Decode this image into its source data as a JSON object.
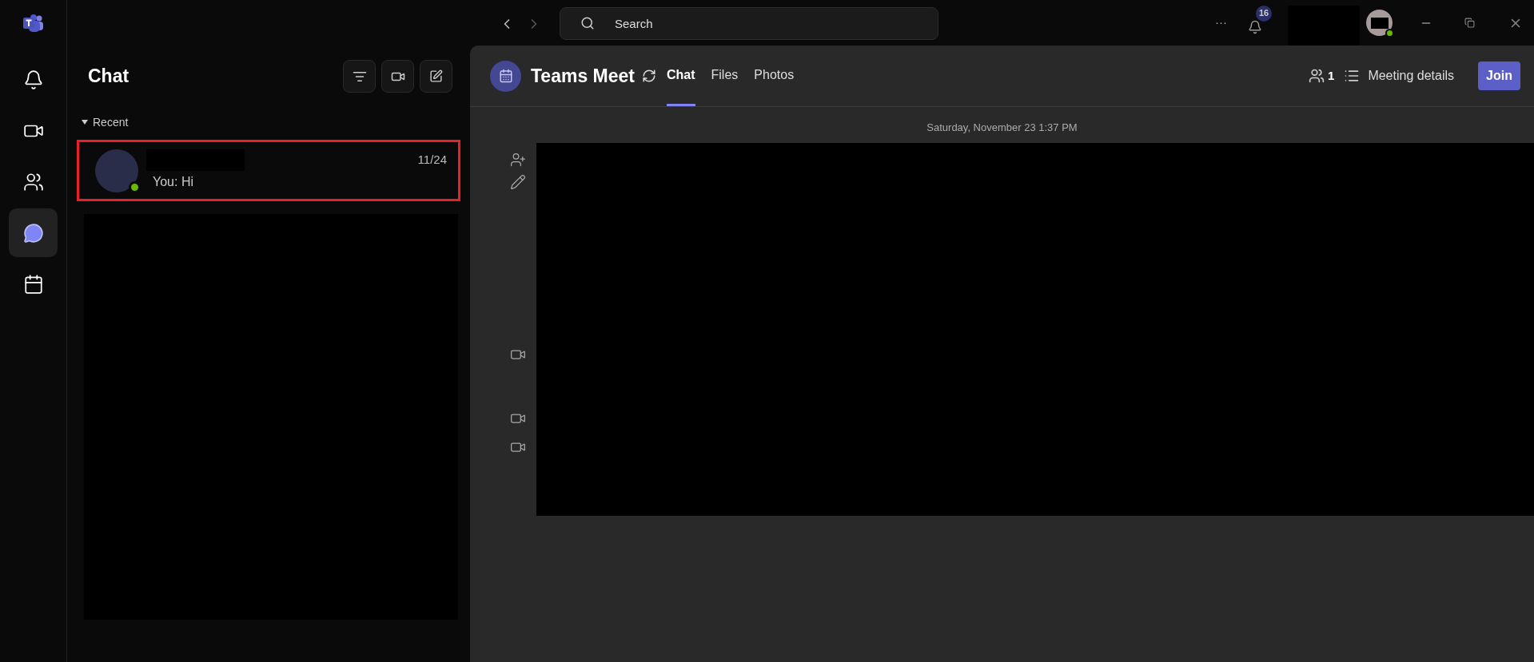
{
  "titlebar": {
    "search": {
      "placeholder": "Search"
    },
    "more": "···",
    "notification_badge": "16",
    "online": true
  },
  "rail": [
    {
      "kind": "bell",
      "selected": false
    },
    {
      "kind": "video",
      "selected": false
    },
    {
      "kind": "people",
      "selected": false
    },
    {
      "kind": "chat",
      "selected": true
    },
    {
      "kind": "calendar",
      "selected": false
    }
  ],
  "chat_list": {
    "title": "Chat",
    "section": "Recent",
    "expanded": true,
    "items": [
      {
        "preview": "You: Hi",
        "time": "11/24",
        "selected": true,
        "online": true
      }
    ]
  },
  "conversation": {
    "title": "Teams Meet",
    "tabs": [
      {
        "label": "Chat",
        "selected": true
      },
      {
        "label": "Files",
        "selected": false
      },
      {
        "label": "Photos",
        "selected": false
      }
    ],
    "participants": "1",
    "details": "Meeting details",
    "join": "Join",
    "timestamp": "Saturday, November 23 1:37 PM",
    "events": [
      {
        "kind": "person-add"
      },
      {
        "kind": "edit"
      },
      {
        "kind": "video"
      },
      {
        "kind": "video"
      },
      {
        "kind": "video"
      }
    ]
  }
}
